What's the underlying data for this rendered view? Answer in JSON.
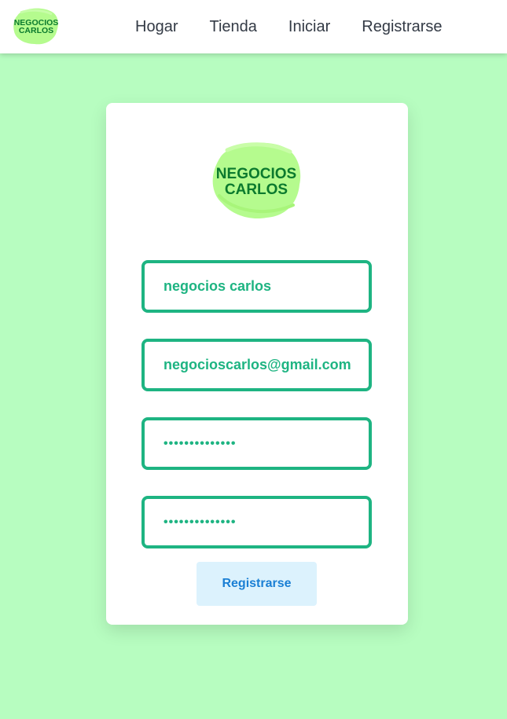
{
  "brand": {
    "logo_line1": "NEGOCIOS",
    "logo_line2": "CARLOS",
    "logo_blob_color": "#b5fb8e",
    "logo_text_color": "#0b7a2e"
  },
  "nav": {
    "items": [
      {
        "label": "Hogar"
      },
      {
        "label": "Tienda"
      },
      {
        "label": "Iniciar"
      },
      {
        "label": "Registrarse"
      }
    ]
  },
  "form": {
    "name_value": "negocios carlos",
    "email_value": "negocioscarlos@gmail.com",
    "password_value": "••••••••••••••",
    "confirm_password_value": "••••••••••••••",
    "submit_label": "Registrarse"
  },
  "colors": {
    "page_bg": "#b7fdc0",
    "accent": "#1eb482",
    "button_bg": "#dcf2fd",
    "button_text": "#1a7fd4"
  }
}
